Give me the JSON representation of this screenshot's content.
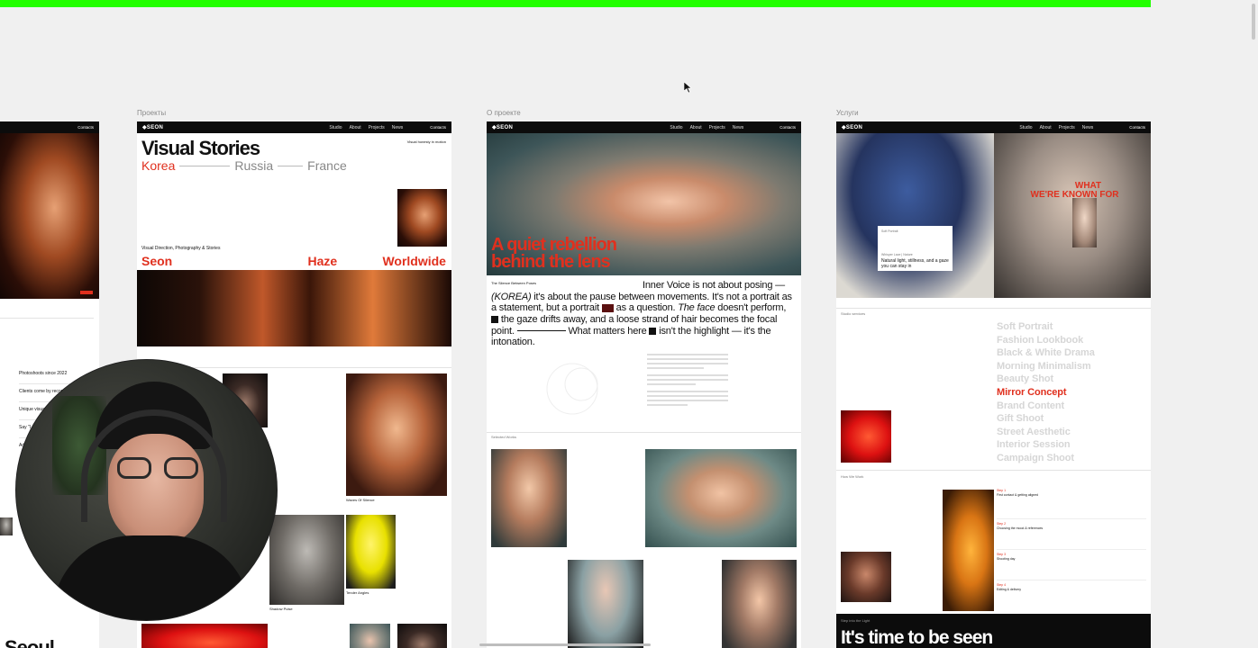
{
  "cursor_icon": "arrow-cursor-icon",
  "frames": {
    "left": {
      "nav_contacts": "Contacts",
      "list_items": [
        "Photoshoots since 2022",
        "Clients come by recommend",
        "Unique visual",
        "Say \"I",
        "Ad"
      ],
      "bottom_title": "Seoul"
    },
    "projects": {
      "label": "Проекты",
      "logo": "◆SEON",
      "nav": [
        "Studio",
        "About",
        "Projects",
        "News"
      ],
      "contacts": "Contacts",
      "hero_title": "Visual Stories",
      "hero_side_text": "Visual honesty in motion",
      "locations": [
        "Korea",
        "Russia",
        "France"
      ],
      "tagline": "Visual Direction, Photography & Stories",
      "big_words": [
        "Seon",
        "Haze",
        "Worldwide"
      ],
      "captions": [
        "Waves Of Silence",
        "Shadow Pulse",
        "Tender Angles"
      ]
    },
    "about": {
      "label": "О проекте",
      "logo": "◆SEON",
      "nav": [
        "Studio",
        "About",
        "Projects",
        "News"
      ],
      "contacts": "Contacts",
      "hero_title_line1": "A quiet rebellion",
      "hero_title_line2": "behind the lens",
      "small_label": "The Silence Between Poses",
      "statement": {
        "p1": "Inner Voice is not about posing —",
        "p2": "(KOREA)",
        "p3": "it's about the pause between movements. It's not a portrait as a statement, but a portrait",
        "p4": "as a question.",
        "p5": "The face",
        "p6": "doesn't perform,",
        "p7": "the gaze drifts away, and a loose strand of hair becomes the focal point.",
        "p8": "What matters here",
        "p9": "isn't the highlight — it's the intonation."
      },
      "section_label": "Selected Works"
    },
    "services": {
      "label": "Услуги",
      "logo": "◆SEON",
      "nav": [
        "Studio",
        "About",
        "Projects",
        "News"
      ],
      "contacts": "Contacts",
      "overlay_heading_1": "WHAT",
      "overlay_heading_2": "WE'RE KNOWN FOR",
      "card_title": "Soft Portrait",
      "card_subtitle": "Whisper Lace | Nature",
      "card_text": "Natural light, stillness, and a gaze you can stay in",
      "section_label": "Studio services",
      "services_list": [
        "Soft Portrait",
        "Fashion Lookbook",
        "Black & White Drama",
        "Morning Minimalism",
        "Beauty Shot",
        "Mirror Concept",
        "Brand Content",
        "Gift Shoot",
        "Street Aesthetic",
        "Interior Session",
        "Campaign Shoot"
      ],
      "active_service": "Mirror Concept",
      "how_label": "How We Work",
      "steps": [
        "Step 1",
        "Step 2",
        "Step 3",
        "Step 4"
      ],
      "step_titles": [
        "First contact & getting aligned",
        "Choosing the mood & references",
        "Shooting day",
        "Editing & delivery"
      ],
      "footer_small": "Step into the Light",
      "footer_title": "It's time to be seen"
    }
  },
  "colors": {
    "accent_red": "#e0301e",
    "top_progress": "#22ff00",
    "canvas": "#f0f0f0"
  }
}
